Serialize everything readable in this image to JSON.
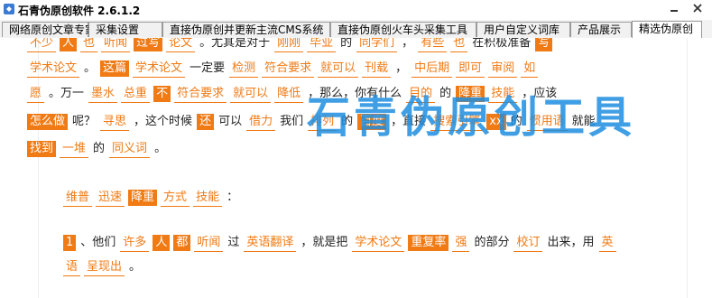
{
  "window": {
    "title": "石青伪原创软件 2.6.1.2",
    "controls": [
      "minimize-icon",
      "close-icon"
    ]
  },
  "tabs": [
    {
      "label": "网络原创文章专家",
      "active": false
    },
    {
      "label": "采集设置",
      "active": false
    },
    {
      "label": "直接伪原创并更新主流CMS系统",
      "active": false
    },
    {
      "label": "直接伪原创火车头采集工具",
      "active": false
    },
    {
      "label": "用户自定义词库",
      "active": false
    },
    {
      "label": "产品展示",
      "active": false
    },
    {
      "label": "精选伪原创",
      "active": true
    }
  ],
  "watermark": "石青伪原创工具",
  "paragraphs": [
    {
      "lines": [
        [
          [
            "不少",
            "k"
          ],
          [
            "人",
            "s"
          ],
          [
            "也",
            "k"
          ],
          [
            "听闻",
            "k"
          ],
          [
            "过写",
            "s"
          ],
          [
            "论文",
            "k"
          ],
          [
            "。尤其是对于",
            "p"
          ],
          [
            "刚刚",
            "k"
          ],
          [
            "毕业",
            "k"
          ],
          [
            "的",
            "p"
          ],
          [
            "同学们",
            "k"
          ],
          [
            "，",
            "p"
          ],
          [
            "有些",
            "k"
          ],
          [
            "也",
            "k"
          ],
          [
            "在积极准备",
            "p"
          ],
          [
            "写",
            "s"
          ]
        ],
        [
          [
            "学术论文",
            "k"
          ],
          [
            "。",
            "p"
          ],
          [
            "这篇",
            "s"
          ],
          [
            "学术论文",
            "k"
          ],
          [
            "一定要",
            "p"
          ],
          [
            "检测",
            "k"
          ],
          [
            "符合要求",
            "k"
          ],
          [
            "就可以",
            "k"
          ],
          [
            "刊载",
            "k"
          ],
          [
            "，",
            "p"
          ],
          [
            "中后期",
            "k"
          ],
          [
            "即可",
            "k"
          ],
          [
            "审阅",
            "k"
          ],
          [
            "如",
            "k"
          ]
        ],
        [
          [
            "愿",
            "k"
          ],
          [
            "。万一",
            "p"
          ],
          [
            "墨水",
            "k"
          ],
          [
            "总重",
            "k"
          ],
          [
            "不",
            "s"
          ],
          [
            "符合要求",
            "k"
          ],
          [
            "就可以",
            "k"
          ],
          [
            "降低",
            "k"
          ],
          [
            "，那么，你有什么",
            "p"
          ],
          [
            "目的",
            "k"
          ],
          [
            "的",
            "p"
          ],
          [
            "降重",
            "s"
          ],
          [
            "技能",
            "k"
          ],
          [
            "，应该",
            "p"
          ]
        ],
        [
          [
            "怎么做",
            "s"
          ],
          [
            "呢？",
            "p"
          ],
          [
            "寻思",
            "k"
          ],
          [
            "，这个时候",
            "p"
          ],
          [
            "还",
            "s"
          ],
          [
            "可以",
            "p"
          ],
          [
            "借力",
            "k"
          ],
          [
            "我们",
            "p"
          ],
          [
            "排列",
            "k"
          ],
          [
            "的",
            "p"
          ],
          [
            "百度",
            "s"
          ],
          [
            "，直接",
            "p"
          ],
          [
            "搜索引擎",
            "k"
          ],
          [
            "xx",
            "s"
          ],
          [
            "的",
            "p"
          ],
          [
            "惯用语",
            "k"
          ],
          [
            "就能",
            "p"
          ]
        ],
        [
          [
            "找到",
            "s"
          ],
          [
            "一堆",
            "k"
          ],
          [
            "的",
            "p"
          ],
          [
            "同义词",
            "k"
          ],
          [
            "。",
            "p"
          ]
        ]
      ]
    },
    {
      "lines": [
        [
          [
            "维普",
            "k"
          ],
          [
            "迅速",
            "k"
          ],
          [
            "降重",
            "s"
          ],
          [
            "方式",
            "k"
          ],
          [
            "技能",
            "k"
          ],
          [
            "：",
            "p"
          ]
        ]
      ]
    },
    {
      "lines": [
        [
          [
            "1",
            "s"
          ],
          [
            "、他们",
            "p"
          ],
          [
            "许多",
            "k"
          ],
          [
            "人",
            "s"
          ],
          [
            "都",
            "s"
          ],
          [
            "听闻",
            "k"
          ],
          [
            "过",
            "p"
          ],
          [
            "英语翻译",
            "k"
          ],
          [
            "，就是把",
            "p"
          ],
          [
            "学术论文",
            "k"
          ],
          [
            "重复率",
            "s"
          ],
          [
            "强",
            "k"
          ],
          [
            "的部分",
            "p"
          ],
          [
            "校订",
            "k"
          ],
          [
            "出来，用",
            "p"
          ],
          [
            "英",
            "k"
          ]
        ],
        [
          [
            "语",
            "k"
          ],
          [
            "呈现出",
            "k"
          ],
          [
            "。",
            "p"
          ]
        ]
      ]
    }
  ]
}
